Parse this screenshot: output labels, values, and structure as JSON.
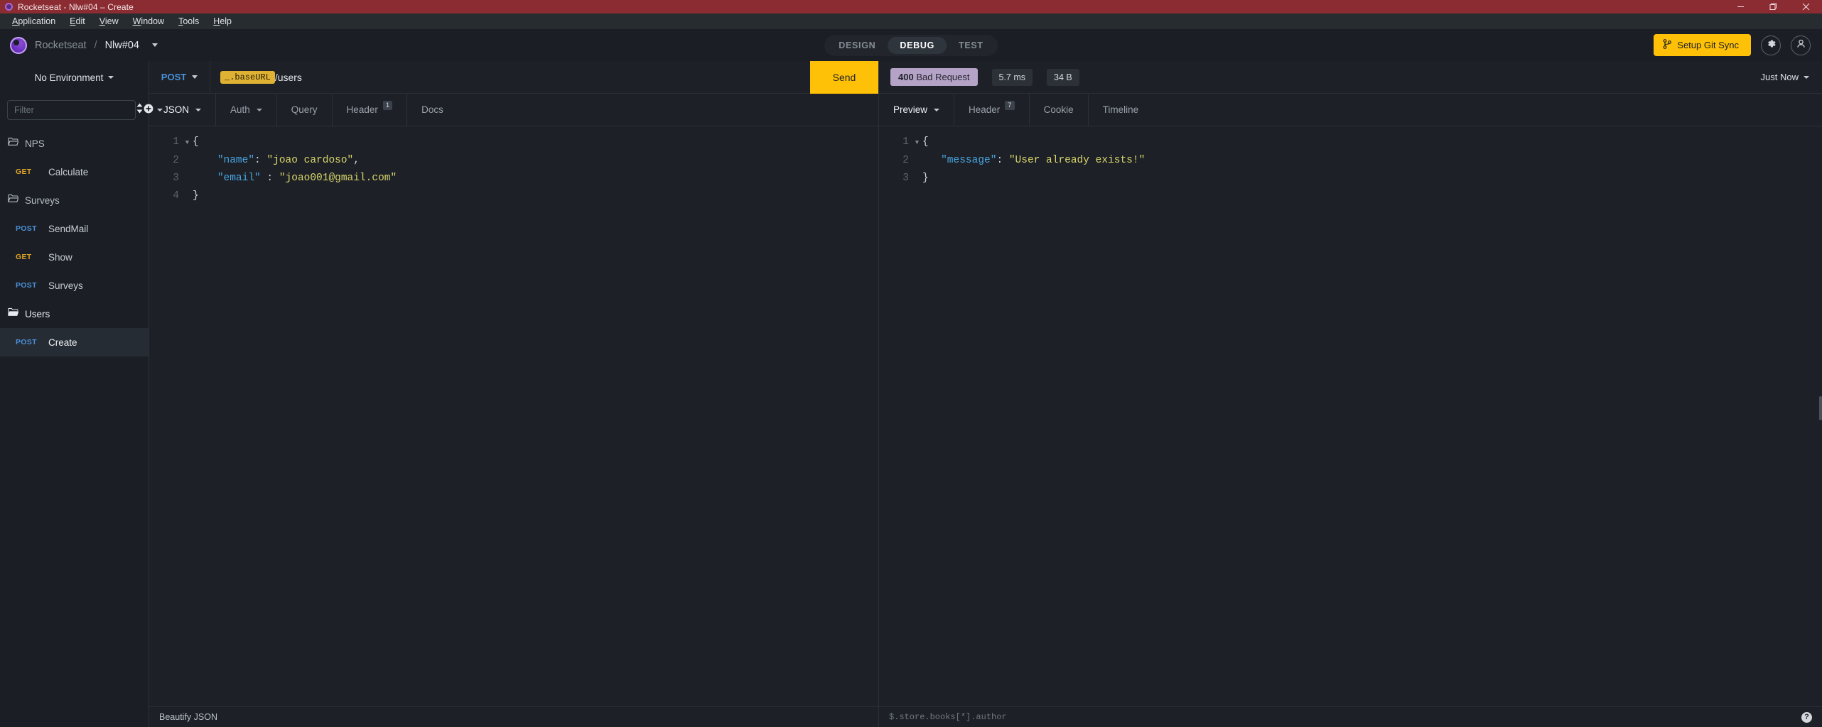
{
  "window": {
    "title": "Rocketseat - Nlw#04 – Create",
    "logo_icon": "insomnia-logo-icon",
    "controls": [
      {
        "name": "minimize-button",
        "icon": "minimize-icon"
      },
      {
        "name": "maximize-button",
        "icon": "restore-icon"
      },
      {
        "name": "close-button",
        "icon": "close-icon"
      }
    ]
  },
  "menubar": {
    "items": [
      {
        "label": "Application",
        "accel": "A"
      },
      {
        "label": "Edit",
        "accel": "E"
      },
      {
        "label": "View",
        "accel": "V"
      },
      {
        "label": "Window",
        "accel": "W"
      },
      {
        "label": "Tools",
        "accel": "T"
      },
      {
        "label": "Help",
        "accel": "H"
      }
    ]
  },
  "header": {
    "org": "Rocketseat",
    "separator": "/",
    "workspace": "Nlw#04",
    "modes": [
      {
        "label": "DESIGN",
        "active": false
      },
      {
        "label": "DEBUG",
        "active": true
      },
      {
        "label": "TEST",
        "active": false
      }
    ],
    "git_sync_label": "Setup Git Sync",
    "git_sync_icon": "git-branch-icon",
    "git_sync_color": "#ffc107",
    "settings_icon": "gear-icon",
    "account_icon": "user-avatar-icon"
  },
  "sidebar": {
    "environment": "No Environment",
    "filter_placeholder": "Filter",
    "sort_icon": "sort-icon",
    "add_icon": "plus-circle-icon",
    "tree": [
      {
        "type": "folder",
        "label": "NPS",
        "icon": "folder-closed-icon",
        "open": false
      },
      {
        "type": "request",
        "method": "GET",
        "label": "Calculate",
        "selected": false
      },
      {
        "type": "folder",
        "label": "Surveys",
        "icon": "folder-closed-icon",
        "open": false
      },
      {
        "type": "request",
        "method": "POST",
        "label": "SendMail",
        "selected": false
      },
      {
        "type": "request",
        "method": "GET",
        "label": "Show",
        "selected": false
      },
      {
        "type": "request",
        "method": "POST",
        "label": "Surveys",
        "selected": false
      },
      {
        "type": "folder",
        "label": "Users",
        "icon": "folder-open-icon",
        "open": true
      },
      {
        "type": "request",
        "method": "POST",
        "label": "Create",
        "selected": true
      }
    ]
  },
  "request": {
    "method": "POST",
    "url_variable": "_.baseURL",
    "url_path": "/users",
    "send_label": "Send",
    "tabs": [
      {
        "label": "JSON",
        "active": true,
        "caret": true,
        "badge": null
      },
      {
        "label": "Auth",
        "active": false,
        "caret": true,
        "badge": null
      },
      {
        "label": "Query",
        "active": false,
        "caret": false,
        "badge": null
      },
      {
        "label": "Header",
        "active": false,
        "caret": false,
        "badge": "1"
      },
      {
        "label": "Docs",
        "active": false,
        "caret": false,
        "badge": null
      }
    ],
    "body_lines": [
      {
        "num": "1",
        "fold": true,
        "tokens": [
          {
            "t": "{",
            "c": "p"
          }
        ]
      },
      {
        "num": "2",
        "fold": false,
        "tokens": [
          {
            "t": "    ",
            "c": "p"
          },
          {
            "t": "\"name\"",
            "c": "k"
          },
          {
            "t": ": ",
            "c": "p"
          },
          {
            "t": "\"joao cardoso\"",
            "c": "s"
          },
          {
            "t": ",",
            "c": "p"
          }
        ]
      },
      {
        "num": "3",
        "fold": false,
        "tokens": [
          {
            "t": "    ",
            "c": "p"
          },
          {
            "t": "\"email\"",
            "c": "k"
          },
          {
            "t": " : ",
            "c": "p"
          },
          {
            "t": "\"joao001@gmail.com\"",
            "c": "s"
          }
        ]
      },
      {
        "num": "4",
        "fold": false,
        "tokens": [
          {
            "t": "}",
            "c": "p"
          }
        ]
      }
    ],
    "footer_label": "Beautify JSON"
  },
  "response": {
    "status_code": "400",
    "status_text": "Bad Request",
    "status_color": "#b4a3c6",
    "time": "5.7 ms",
    "size": "34 B",
    "history_label": "Just Now",
    "tabs": [
      {
        "label": "Preview",
        "active": true,
        "caret": true,
        "badge": null
      },
      {
        "label": "Header",
        "active": false,
        "caret": false,
        "badge": "7"
      },
      {
        "label": "Cookie",
        "active": false,
        "caret": false,
        "badge": null
      },
      {
        "label": "Timeline",
        "active": false,
        "caret": false,
        "badge": null
      }
    ],
    "body_lines": [
      {
        "num": "1",
        "fold": true,
        "tokens": [
          {
            "t": "{",
            "c": "p"
          }
        ]
      },
      {
        "num": "2",
        "fold": false,
        "tokens": [
          {
            "t": "   ",
            "c": "p"
          },
          {
            "t": "\"message\"",
            "c": "k"
          },
          {
            "t": ": ",
            "c": "p"
          },
          {
            "t": "\"User already exists!\"",
            "c": "s"
          }
        ]
      },
      {
        "num": "3",
        "fold": false,
        "tokens": [
          {
            "t": "}",
            "c": "p"
          }
        ]
      }
    ],
    "filter_placeholder": "$.store.books[*].author",
    "help_icon": "question-mark-icon",
    "help_label": "?"
  }
}
